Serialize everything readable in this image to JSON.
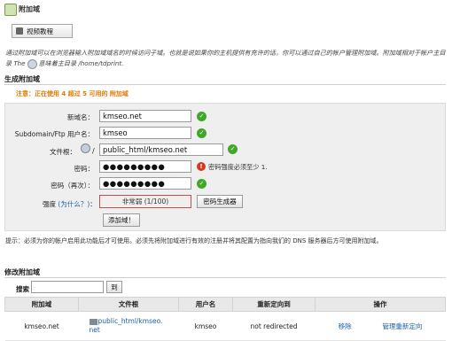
{
  "page": {
    "title": "附加域",
    "video_button": "视频教程"
  },
  "intro": {
    "text_a": "通过附加域可以在浏览器输入附加域域名的时候访问子域。也就是说如果你的主机提供有充许的话，你可以通过自己的帐户管理附加域。附加域相对于帐户主目录 The",
    "text_b": "意味着主目录 /home/tdprint."
  },
  "create": {
    "section_title": "生成附加域",
    "notice": "注意：正在使用 4 超过 5 可用的 附加域",
    "fields": {
      "domain": {
        "label": "新域名：",
        "value": "kmseo.net"
      },
      "subdomain": {
        "label": "Subdomain/Ftp 用户名：",
        "value": "kmseo"
      },
      "docroot": {
        "label": "文件根：",
        "prefix": "/",
        "value": "public_html/kmseo.net"
      },
      "password": {
        "label": "密码：",
        "value": "●●●●●●●●●",
        "error": "密码强度必须至少 1."
      },
      "password_again": {
        "label": "密码（再次）：",
        "value": "●●●●●●●●●"
      },
      "strength": {
        "label": "强度",
        "why_link": "(为什么？)",
        "label_end": "：",
        "value": "非常弱 (1/100)",
        "generator_button": "密码生成器"
      }
    },
    "submit_button": "添加域！",
    "tip": "提示：必须为你的帐户启用此功能后才可使用。必须先将附加域进行有效的注册并将其配置为指向我们的 DNS 服务器后方可使用附加域。"
  },
  "modify": {
    "section_title": "修改附加域",
    "search_label": "搜索",
    "search_value": "",
    "go_button": "到",
    "columns": [
      "附加域",
      "文件根",
      "用户名",
      "重新定向到",
      "操作"
    ],
    "rows": [
      {
        "domain": "kmseo.net",
        "docroot_line1": "public_html/kmseo.",
        "docroot_line2": "net",
        "user": "kmseo",
        "redirect": "not redirected",
        "action_remove": "移除",
        "action_redirect": "管理重新定向"
      }
    ]
  },
  "colors": {
    "notice": "#e07a00",
    "link": "#1a5fa8",
    "ok": "#41a62a",
    "error": "#d13a1f",
    "form_bg": "#efefef"
  },
  "icons": [
    "domain-icon",
    "video-icon",
    "globe-icon",
    "check-icon",
    "warning-icon",
    "folder-icon"
  ]
}
